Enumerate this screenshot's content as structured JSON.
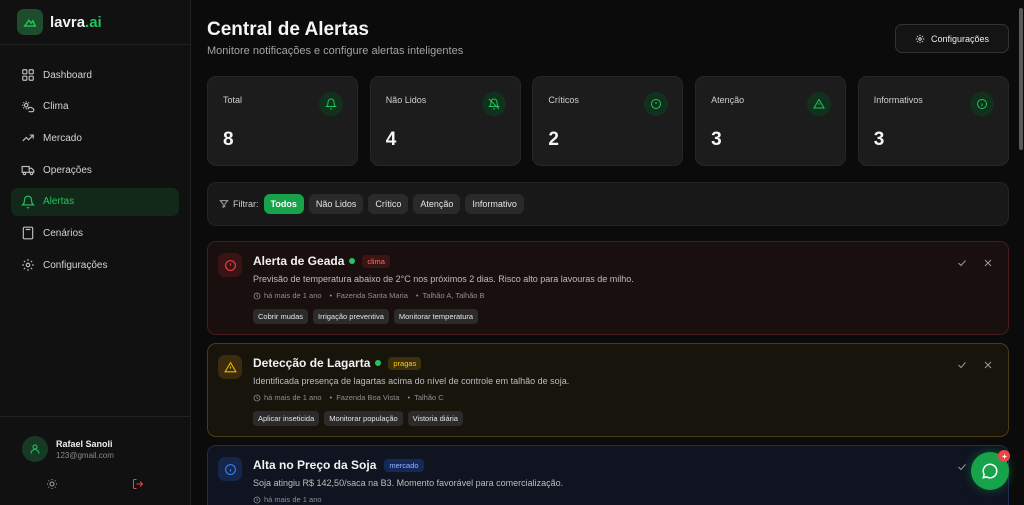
{
  "brand": {
    "name": "lavra",
    "suffix": ".ai"
  },
  "nav": [
    {
      "label": "Dashboard",
      "icon": "dashboard-icon"
    },
    {
      "label": "Clima",
      "icon": "weather-icon"
    },
    {
      "label": "Mercado",
      "icon": "trending-up-icon"
    },
    {
      "label": "Operações",
      "icon": "truck-icon"
    },
    {
      "label": "Alertas",
      "icon": "bell-icon",
      "active": true
    },
    {
      "label": "Cenários",
      "icon": "calculator-icon"
    },
    {
      "label": "Configurações",
      "icon": "gear-icon"
    }
  ],
  "user": {
    "name": "Rafael Sanoli",
    "email": "123@gmail.com"
  },
  "header": {
    "title": "Central de Alertas",
    "subtitle": "Monitore notificações e configure alertas inteligentes",
    "config_label": "Configurações"
  },
  "stats": [
    {
      "label": "Total",
      "value": "8",
      "icon": "bell-icon"
    },
    {
      "label": "Não Lidos",
      "value": "4",
      "icon": "bell-off-icon"
    },
    {
      "label": "Críticos",
      "value": "2",
      "icon": "alert-circle-icon"
    },
    {
      "label": "Atenção",
      "value": "3",
      "icon": "warning-triangle-icon"
    },
    {
      "label": "Informativos",
      "value": "3",
      "icon": "info-icon"
    }
  ],
  "filter": {
    "label": "Filtrar:",
    "chips": [
      "Todos",
      "Não Lidos",
      "Crítico",
      "Atenção",
      "Informativo"
    ],
    "active": "Todos"
  },
  "alerts": [
    {
      "title": "Alerta de Geada",
      "tag": "clima",
      "description": "Previsão de temperatura abaixo de 2°C nos próximos 2 dias. Risco alto para lavouras de milho.",
      "time": "há mais de 1 ano",
      "farm": "Fazenda Santa Maria",
      "plots": "Talhão A, Talhão B",
      "actions": [
        "Cobrir mudas",
        "Irrigação preventiva",
        "Monitorar temperatura"
      ],
      "color": "#ef4444"
    },
    {
      "title": "Detecção de Lagarta",
      "tag": "pragas",
      "description": "Identificada presença de lagartas acima do nível de controle em talhão de soja.",
      "time": "há mais de 1 ano",
      "farm": "Fazenda Boa Vista",
      "plots": "Talhão C",
      "actions": [
        "Aplicar inseticida",
        "Monitorar população",
        "Vistoria diária"
      ],
      "color": "#eab308"
    },
    {
      "title": "Alta no Preço da Soja",
      "tag": "mercado",
      "description": "Soja atingiu R$ 142,50/saca na B3. Momento favorável para comercialização.",
      "time": "há mais de 1 ano",
      "color": "#3b82f6"
    }
  ],
  "colors": {
    "accent": "#22c55e",
    "critical": "#ef4444",
    "warning": "#eab308",
    "info": "#3b82f6"
  }
}
